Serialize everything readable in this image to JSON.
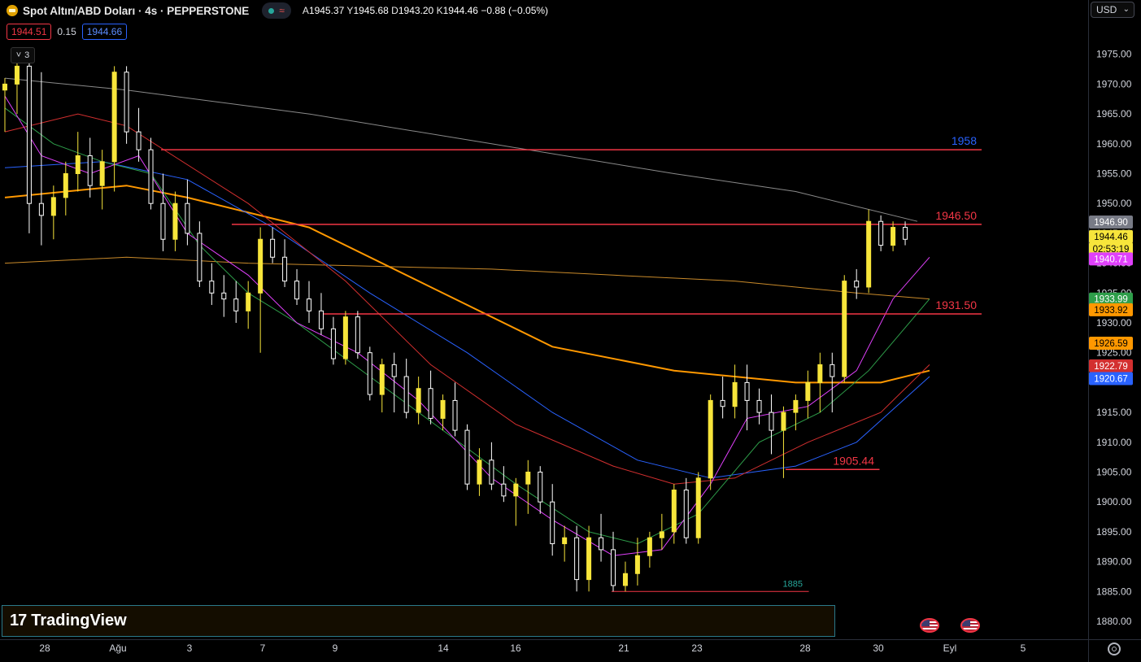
{
  "header": {
    "title": "Spot Altın/ABD Doları · 4s · PEPPERSTONE",
    "ohlc": [
      {
        "label": "A",
        "value": "1945.37"
      },
      {
        "label": "Y",
        "value": "1945.68"
      },
      {
        "label": "D",
        "value": "1943.20"
      },
      {
        "label": "K",
        "value": "1944.46"
      }
    ],
    "change": "−0.88 (−0.05%)",
    "status_wave": "≈"
  },
  "trade": {
    "bid": "1944.51",
    "spread": "0.15",
    "ask": "1944.66"
  },
  "collapse": {
    "count": "3",
    "chevron": "˅"
  },
  "currency": {
    "label": "USD",
    "chevron": "⌄"
  },
  "branding": {
    "logo_mark": "17",
    "logo_text": "TradingView"
  },
  "colors": {
    "bull": "#f7e53b",
    "bear": "#ffffff",
    "hline": "#f23645",
    "ma_gray": "#8a8a8a",
    "ma_orange_thick": "#ff9800",
    "ma_orange_thin": "#c98a2a",
    "ma_blue": "#2962ff",
    "ma_red": "#d32f2f",
    "ma_green": "#2e9e4a",
    "ma_magenta": "#e040fb"
  },
  "chart_data": {
    "type": "candlestick",
    "yaxis": {
      "ticks": [
        "1975.00",
        "1970.00",
        "1965.00",
        "1960.00",
        "1955.00",
        "1950.00",
        "1945.00",
        "1940.00",
        "1935.00",
        "1930.00",
        "1925.00",
        "1915.00",
        "1910.00",
        "1905.00",
        "1900.00",
        "1895.00",
        "1890.00",
        "1885.00",
        "1880.00"
      ],
      "range": [
        1877,
        1980
      ]
    },
    "xaxis": {
      "labels": [
        "28",
        "Ağu",
        "3",
        "7",
        "9",
        "14",
        "16",
        "21",
        "23",
        "28",
        "30",
        "Eyl",
        "5"
      ]
    },
    "horizontal_levels": [
      {
        "value": 1959,
        "from": 0.148,
        "to": 1,
        "label": "1958",
        "label_color": "#2962ff"
      },
      {
        "value": 1946.5,
        "from": 0.213,
        "to": 1,
        "label": "1946.50",
        "label_color": "#f23645"
      },
      {
        "value": 1931.5,
        "from": 0.295,
        "to": 1,
        "label": "1931.50",
        "label_color": "#f23645"
      },
      {
        "value": 1905.44,
        "from": 0.722,
        "to": 0.896,
        "label": "1905.44",
        "label_color": "#f23645"
      },
      {
        "value": 1885,
        "from": 0.562,
        "to": 0.824,
        "label": "1885",
        "label_color": "#26a69a"
      }
    ],
    "price_badges": [
      {
        "value": "1946.90",
        "bg": "#787b86",
        "fg": "#ffffff",
        "y": 1946.9
      },
      {
        "value": "1944.46",
        "bg": "#f7e53b",
        "fg": "#000000",
        "y": 1944.46
      },
      {
        "value": "02:53:19",
        "bg": "#f7e53b",
        "fg": "#000000",
        "y": 1942.4
      },
      {
        "value": "1940.71",
        "bg": "#e040fb",
        "fg": "#ffffff",
        "y": 1940.71
      },
      {
        "value": "1933.99",
        "bg": "#2e9e4a",
        "fg": "#ffffff",
        "y": 1933.99
      },
      {
        "value": "1933.92",
        "bg": "#ff9800",
        "fg": "#000000",
        "y": 1932.2
      },
      {
        "value": "1926.59",
        "bg": "#ff9800",
        "fg": "#000000",
        "y": 1926.59
      },
      {
        "value": "1922.79",
        "bg": "#d32f2f",
        "fg": "#ffffff",
        "y": 1922.79
      },
      {
        "value": "1920.67",
        "bg": "#2962ff",
        "fg": "#ffffff",
        "y": 1920.67
      }
    ],
    "candles": [
      [
        0.0,
        1969,
        1971,
        1962,
        1970
      ],
      [
        0.01,
        1970,
        1975,
        1965,
        1973
      ],
      [
        0.02,
        1973,
        1974,
        1945,
        1950
      ],
      [
        0.03,
        1950,
        1972,
        1943,
        1948
      ],
      [
        0.04,
        1948,
        1953,
        1944,
        1951
      ],
      [
        0.05,
        1951,
        1957,
        1948,
        1955
      ],
      [
        0.06,
        1955,
        1962,
        1952,
        1958
      ],
      [
        0.07,
        1958,
        1961,
        1951,
        1953
      ],
      [
        0.08,
        1953,
        1959,
        1949,
        1957
      ],
      [
        0.09,
        1957,
        1973,
        1952,
        1972
      ],
      [
        0.1,
        1972,
        1973,
        1960,
        1962
      ],
      [
        0.11,
        1962,
        1966,
        1957,
        1959
      ],
      [
        0.12,
        1959,
        1961,
        1949,
        1950
      ],
      [
        0.13,
        1950,
        1955,
        1942,
        1944
      ],
      [
        0.14,
        1944,
        1952,
        1942,
        1950
      ],
      [
        0.15,
        1950,
        1954,
        1943,
        1945
      ],
      [
        0.16,
        1945,
        1947,
        1936,
        1937
      ],
      [
        0.17,
        1937,
        1940,
        1933,
        1935
      ],
      [
        0.18,
        1935,
        1938,
        1931,
        1934
      ],
      [
        0.19,
        1934,
        1937,
        1930,
        1932
      ],
      [
        0.2,
        1932,
        1937,
        1929,
        1935
      ],
      [
        0.21,
        1935,
        1946,
        1925,
        1944
      ],
      [
        0.22,
        1944,
        1946,
        1940,
        1941
      ],
      [
        0.23,
        1941,
        1944,
        1936,
        1937
      ],
      [
        0.24,
        1937,
        1939,
        1933,
        1934
      ],
      [
        0.25,
        1934,
        1937,
        1930,
        1932
      ],
      [
        0.26,
        1932,
        1935,
        1928,
        1929
      ],
      [
        0.27,
        1929,
        1931,
        1923,
        1924
      ],
      [
        0.28,
        1924,
        1932,
        1923,
        1931
      ],
      [
        0.29,
        1931,
        1932,
        1924,
        1925
      ],
      [
        0.3,
        1925,
        1926,
        1917,
        1918
      ],
      [
        0.31,
        1918,
        1924,
        1915,
        1923
      ],
      [
        0.32,
        1923,
        1925,
        1915,
        1921
      ],
      [
        0.33,
        1921,
        1924,
        1914,
        1915
      ],
      [
        0.34,
        1915,
        1921,
        1913,
        1919
      ],
      [
        0.35,
        1919,
        1922,
        1913,
        1914
      ],
      [
        0.36,
        1914,
        1918,
        1912,
        1917
      ],
      [
        0.37,
        1917,
        1920,
        1911,
        1912
      ],
      [
        0.38,
        1912,
        1913,
        1902,
        1903
      ],
      [
        0.39,
        1903,
        1909,
        1901,
        1907
      ],
      [
        0.4,
        1907,
        1910,
        1902,
        1903
      ],
      [
        0.41,
        1903,
        1906,
        1900,
        1901
      ],
      [
        0.42,
        1901,
        1904,
        1896,
        1903
      ],
      [
        0.43,
        1903,
        1907,
        1898,
        1905
      ],
      [
        0.44,
        1905,
        1906,
        1898,
        1900
      ],
      [
        0.45,
        1900,
        1903,
        1891,
        1893
      ],
      [
        0.46,
        1893,
        1896,
        1890,
        1894
      ],
      [
        0.47,
        1894,
        1896,
        1885,
        1887
      ],
      [
        0.48,
        1887,
        1896,
        1885,
        1894
      ],
      [
        0.49,
        1894,
        1898,
        1890,
        1892
      ],
      [
        0.5,
        1892,
        1895,
        1885,
        1886
      ],
      [
        0.51,
        1886,
        1890,
        1885,
        1888
      ],
      [
        0.52,
        1888,
        1894,
        1886,
        1891
      ],
      [
        0.53,
        1891,
        1895,
        1889,
        1894
      ],
      [
        0.54,
        1894,
        1898,
        1892,
        1895
      ],
      [
        0.55,
        1895,
        1903,
        1893,
        1902
      ],
      [
        0.56,
        1902,
        1904,
        1893,
        1894
      ],
      [
        0.57,
        1894,
        1905,
        1893,
        1904
      ],
      [
        0.58,
        1904,
        1918,
        1902,
        1917
      ],
      [
        0.59,
        1917,
        1921,
        1914,
        1916
      ],
      [
        0.6,
        1916,
        1923,
        1914,
        1920
      ],
      [
        0.61,
        1920,
        1923,
        1912,
        1917
      ],
      [
        0.62,
        1917,
        1919,
        1913,
        1915
      ],
      [
        0.63,
        1915,
        1918,
        1908,
        1912
      ],
      [
        0.64,
        1912,
        1916,
        1904,
        1915
      ],
      [
        0.65,
        1915,
        1918,
        1912,
        1917
      ],
      [
        0.66,
        1917,
        1922,
        1914,
        1920
      ],
      [
        0.67,
        1920,
        1925,
        1915,
        1923
      ],
      [
        0.68,
        1923,
        1925,
        1915,
        1921
      ],
      [
        0.69,
        1921,
        1938,
        1920,
        1937
      ],
      [
        0.7,
        1937,
        1939,
        1934,
        1936
      ],
      [
        0.71,
        1936,
        1949,
        1935,
        1947
      ],
      [
        0.72,
        1947,
        1948,
        1942,
        1943
      ],
      [
        0.73,
        1943,
        1947,
        1942,
        1946
      ],
      [
        0.74,
        1946,
        1947,
        1943,
        1944
      ]
    ]
  }
}
